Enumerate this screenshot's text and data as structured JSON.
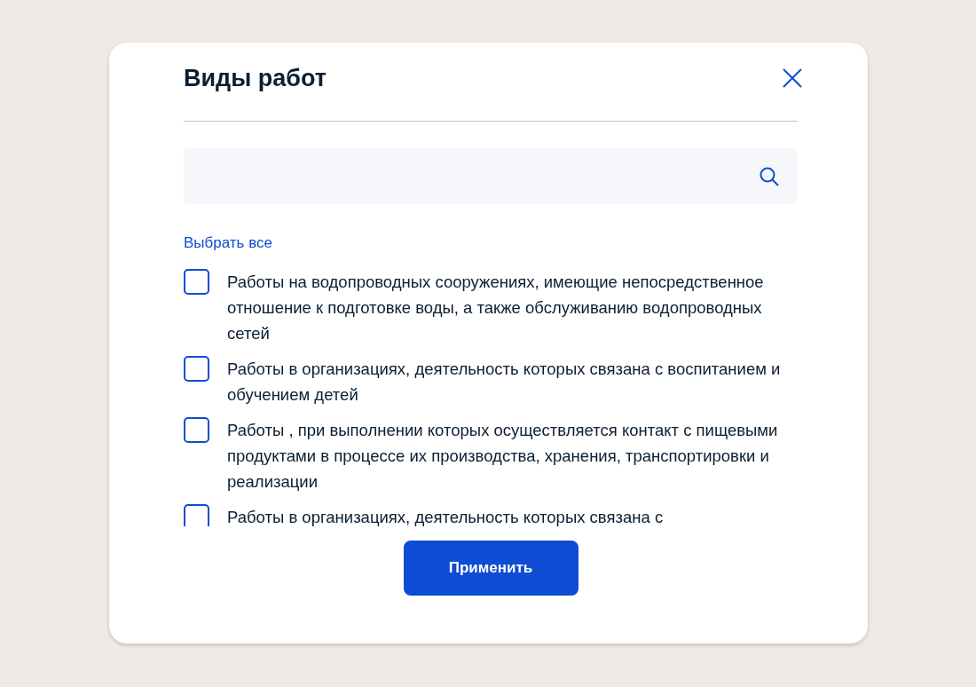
{
  "dialog": {
    "title": "Виды работ"
  },
  "select_all": "Выбрать все",
  "items": [
    {
      "label": "Работы на водопроводных сооружениях, имеющие непосредственное отношение к подготовке воды, а также обслуживанию водопроводных сетей",
      "checked": false
    },
    {
      "label": "Работы в организациях, деятельность которых связана с воспитанием и обучением детей",
      "checked": false
    },
    {
      "label": "Работы , при выполнении которых осуществляется контакт с пищевыми продуктами в процессе их производства, хранения, транспортировки и реализации",
      "checked": false
    },
    {
      "label": "Работы в организациях, деятельность которых связана с",
      "checked": false
    }
  ],
  "apply_button": "Применить"
}
